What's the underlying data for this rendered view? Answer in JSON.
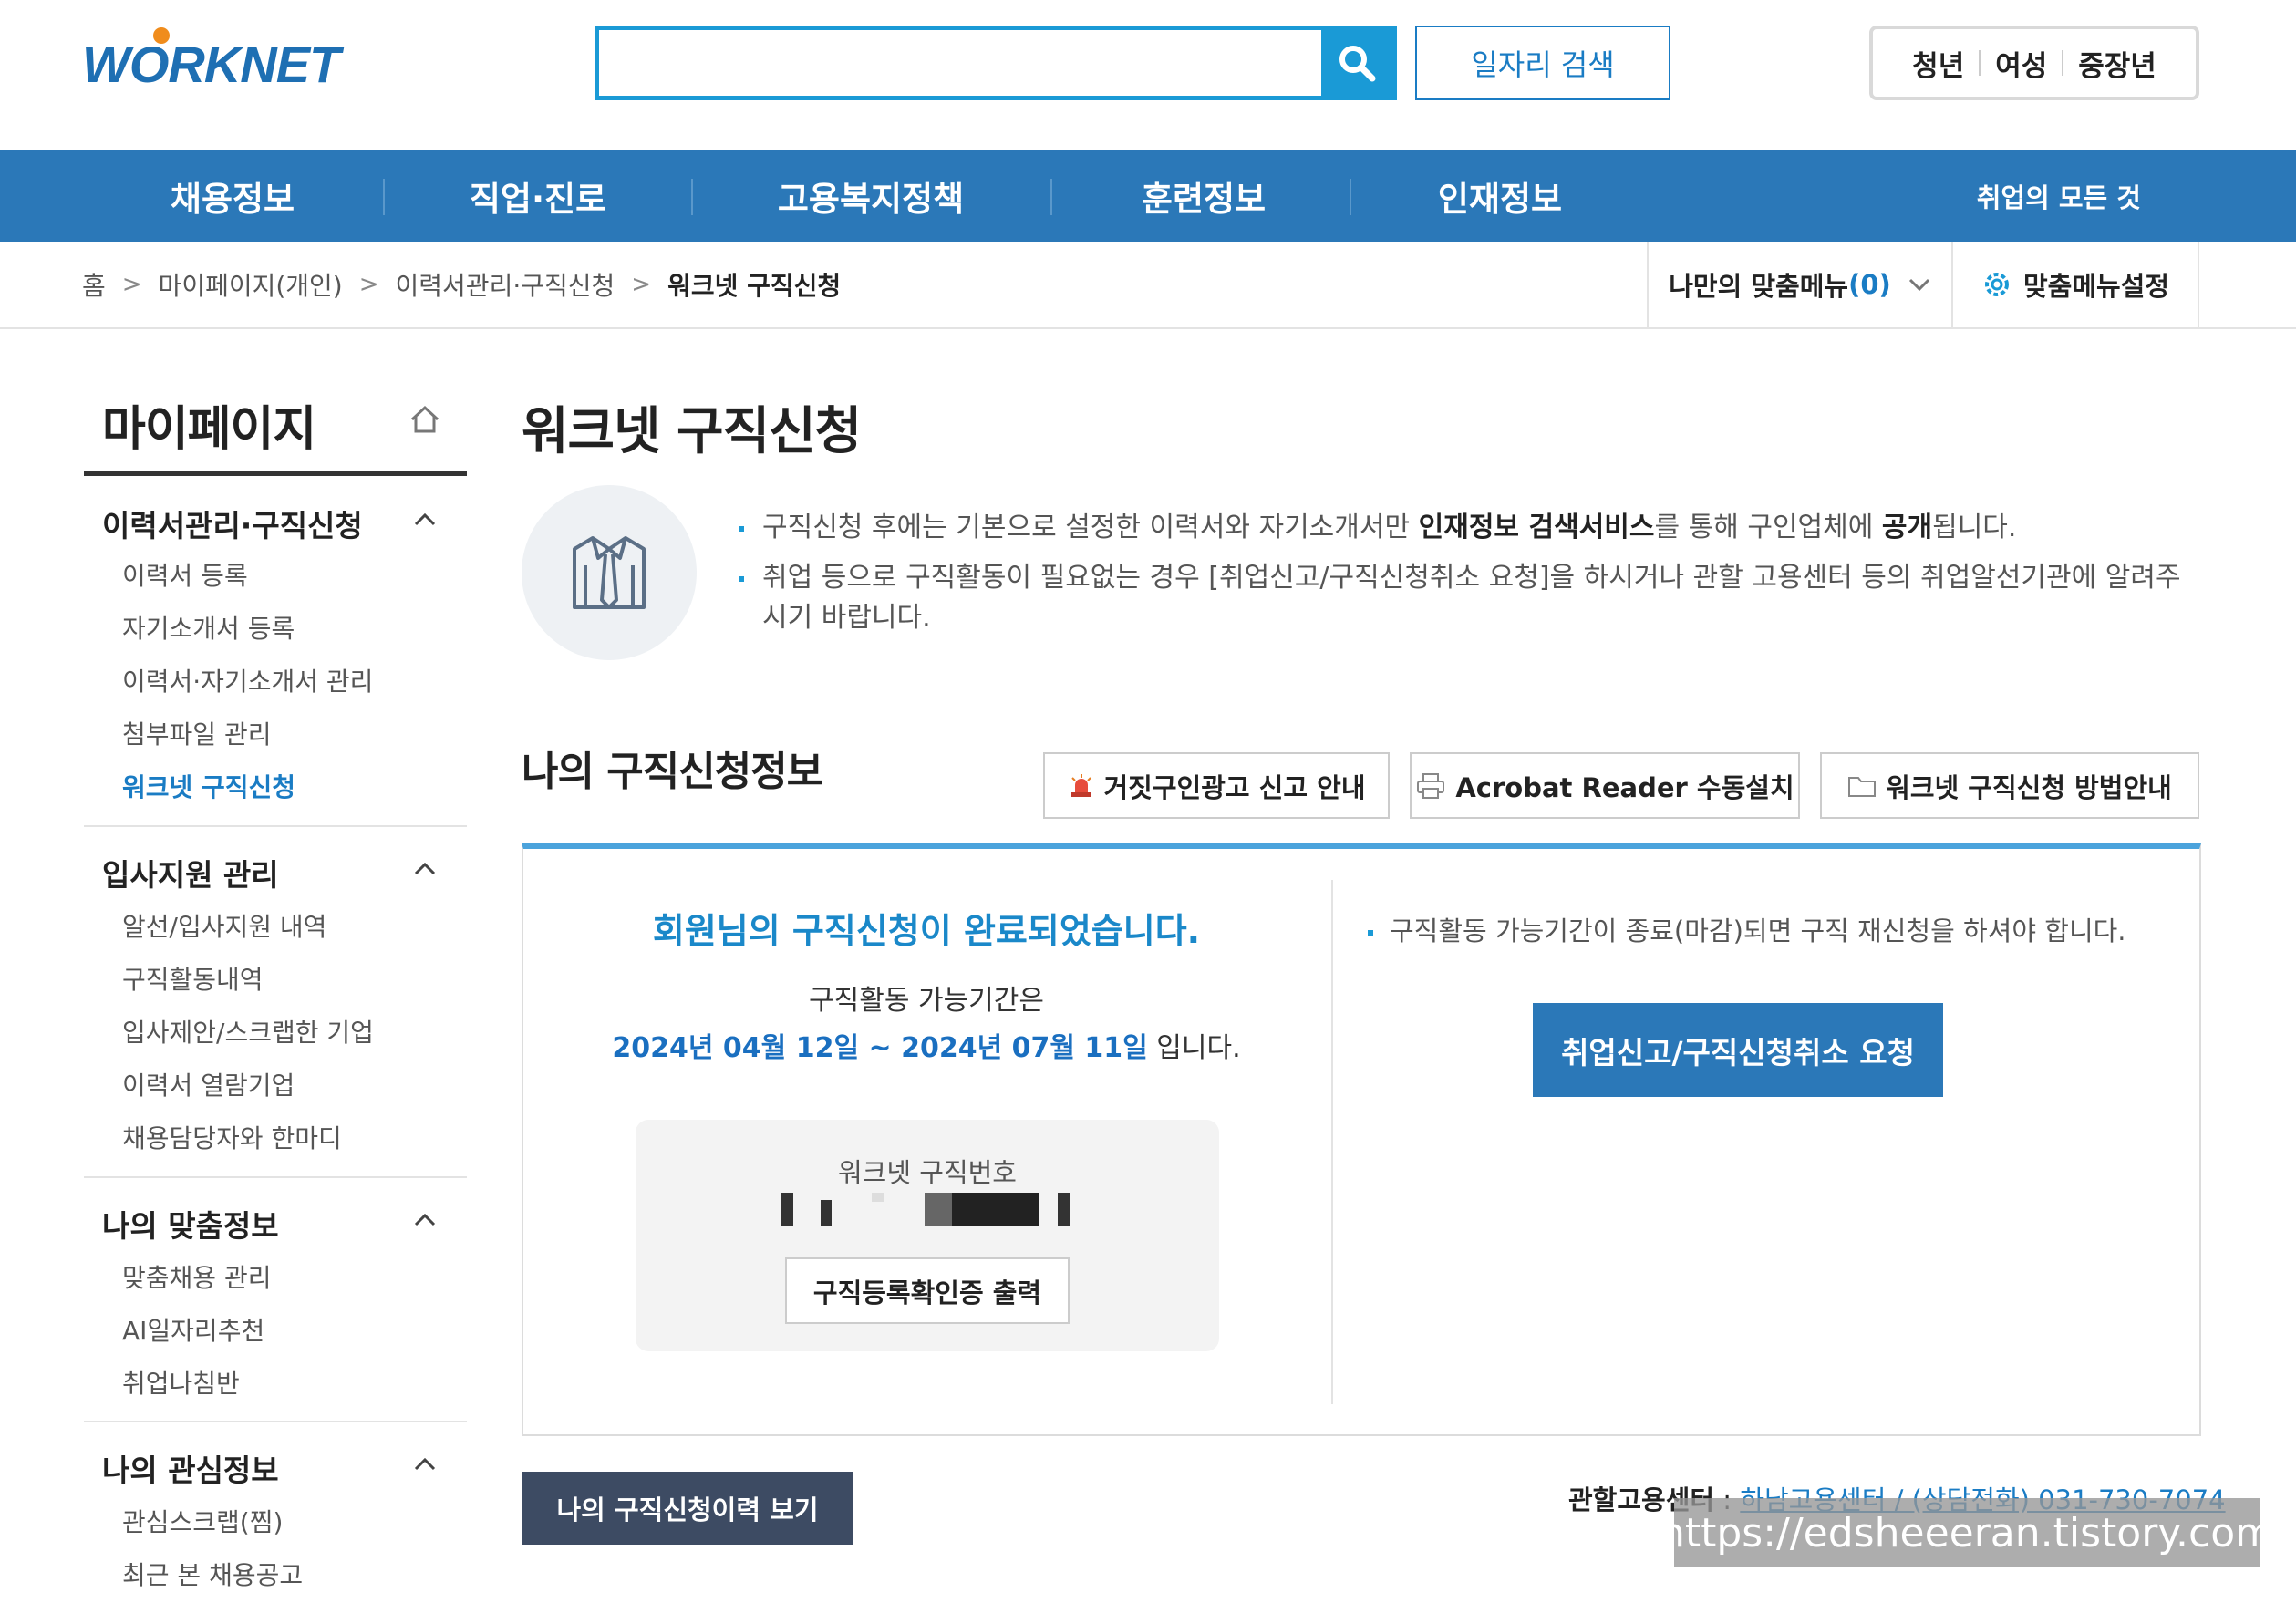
{
  "header": {
    "logo_text": "WORKNET",
    "search_value": "",
    "job_search_label": "일자리 검색",
    "audience": [
      "청년",
      "여성",
      "중장년"
    ]
  },
  "gnb": {
    "items": [
      "채용정보",
      "직업·진로",
      "고용복지정책",
      "훈련정보",
      "인재정보"
    ],
    "right_link": "취업의 모든 것"
  },
  "breadcrumb": {
    "items": [
      "홈",
      "마이페이지(개인)",
      "이력서관리·구직신청",
      "워크넷 구직신청"
    ],
    "my_menu_label": "나만의 맞춤메뉴",
    "my_menu_count": "(0)",
    "menu_settings_label": "맞춤메뉴설정"
  },
  "sidebar": {
    "title": "마이페이지",
    "groups": [
      {
        "title": "이력서관리·구직신청",
        "items": [
          "이력서 등록",
          "자기소개서 등록",
          "이력서·자기소개서 관리",
          "첨부파일 관리",
          "워크넷 구직신청"
        ],
        "active_index": 4
      },
      {
        "title": "입사지원 관리",
        "items": [
          "알선/입사지원 내역",
          "구직활동내역",
          "입사제안/스크랩한 기업",
          "이력서 열람기업",
          "채용담당자와 한마디"
        ]
      },
      {
        "title": "나의 맞춤정보",
        "items": [
          "맞춤채용 관리",
          "AI일자리추천",
          "취업나침반"
        ]
      },
      {
        "title": "나의 관심정보",
        "items": [
          "관심스크랩(찜)",
          "최근 본 채용공고"
        ]
      }
    ]
  },
  "main": {
    "page_title": "워크넷 구직신청",
    "notice1": {
      "pre": "구직신청 후에는 기본으로 설정한 이력서와 자기소개서만 ",
      "bold1": "인재정보 검색서비스",
      "mid": "를 통해 구인업체에 ",
      "bold2": "공개",
      "post": "됩니다."
    },
    "notice2_line1": "취업 등으로 구직활동이 필요없는 경우 [취업신고/구직신청취소 요청]을 하시거나 관할 고용센터 등의 취업알선기관에 알려주",
    "notice2_line2": "시기 바랍니다.",
    "section_title": "나의 구직신청정보",
    "tools": [
      "거짓구인광고 신고 안내",
      "Acrobat Reader 수동설치",
      "워크넷 구직신청 방법안내"
    ],
    "complete_msg": "회원님의 구직신청이 완료되었습니다.",
    "period_label": "구직활동 가능기간은",
    "period_start": "2024년 04월 12일",
    "period_sep": " ~ ",
    "period_end": "2024년 07월 11일",
    "period_suffix": " 입니다.",
    "job_no_label": "워크넷 구직번호",
    "cert_button": "구직등록확인증 출력",
    "reapply_note": "구직활동 가능기간이 종료(마감)되면 구직 재신청을 하셔야 합니다.",
    "cancel_button": "취업신고/구직신청취소 요청",
    "history_button": "나의 구직신청이력 보기",
    "center_label": "관할고용센터",
    "center_colon": " : ",
    "center_value": "하남고용센터 / (상담전화) 031-730-7074"
  },
  "watermark": "https://edsheeeran.tistory.com",
  "colors": {
    "primary": "#2b78b8",
    "accent": "#1a9ad6",
    "dark_button": "#3d4b63"
  }
}
